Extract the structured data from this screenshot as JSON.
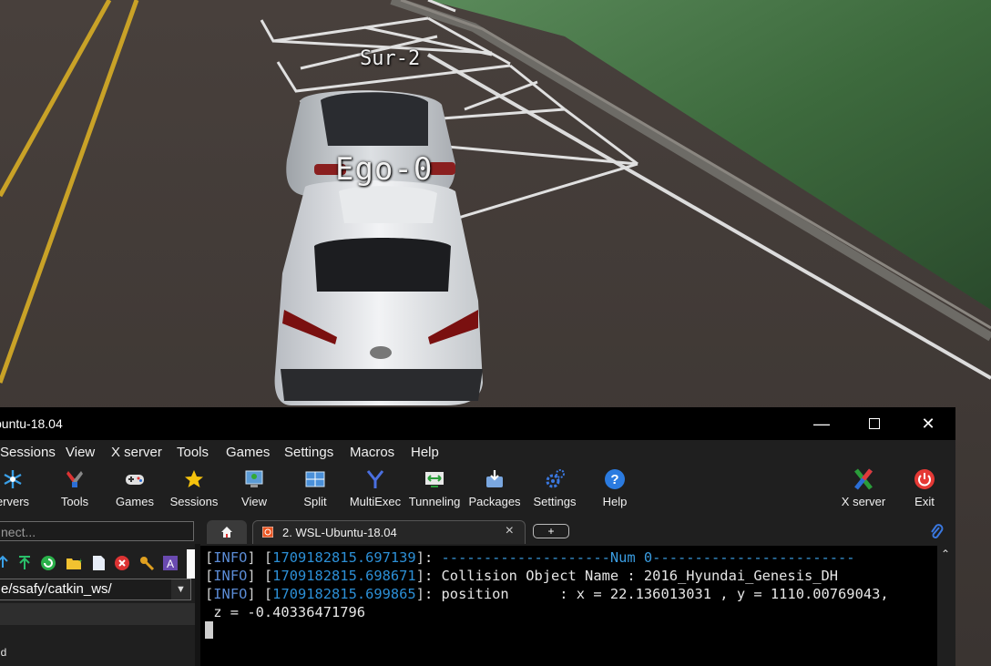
{
  "scene": {
    "surrounding_label": "Sur-2",
    "ego_label": "Ego-0"
  },
  "window": {
    "title": "buntu-18.04",
    "controls": [
      "minimize",
      "maximize",
      "close"
    ]
  },
  "menu": [
    "Sessions",
    "View",
    "X server",
    "Tools",
    "Games",
    "Settings",
    "Macros",
    "Help"
  ],
  "toolbar": {
    "left": [
      {
        "label": "ervers",
        "icon": "servers-icon"
      },
      {
        "label": "Tools",
        "icon": "tools-icon"
      },
      {
        "label": "Games",
        "icon": "gamepad-icon"
      },
      {
        "label": "Sessions",
        "icon": "star-icon"
      },
      {
        "label": "View",
        "icon": "view-icon"
      },
      {
        "label": "Split",
        "icon": "split-icon"
      },
      {
        "label": "MultiExec",
        "icon": "multiexec-icon"
      },
      {
        "label": "Tunneling",
        "icon": "tunneling-icon"
      },
      {
        "label": "Packages",
        "icon": "packages-icon"
      },
      {
        "label": "Settings",
        "icon": "settings-icon"
      },
      {
        "label": "Help",
        "icon": "help-icon"
      }
    ],
    "right": [
      {
        "label": "X server",
        "icon": "xserver-icon"
      },
      {
        "label": "Exit",
        "icon": "power-icon"
      }
    ]
  },
  "sidebar": {
    "connect_placeholder": "nect...",
    "path": "e/ssafy/catkin_ws/",
    "tree_item": "ld"
  },
  "tabs": {
    "home_icon": "home-icon",
    "active_tab": "2. WSL-Ubuntu-18.04",
    "new_tab_label": "+"
  },
  "terminal": {
    "lines": [
      {
        "level": "INFO",
        "timestamp": "1709182815.697139",
        "message": "--------------------Num 0------------------------"
      },
      {
        "level": "INFO",
        "timestamp": "1709182815.698671",
        "message": "Collision Object Name : 2016_Hyundai_Genesis_DH"
      },
      {
        "level": "INFO",
        "timestamp": "1709182815.699865",
        "message": "position      : x = 22.136013031 , y = 1110.00769043,"
      }
    ],
    "continuation": " z = -0.40336471796"
  },
  "colors": {
    "terminal_bg": "#000000",
    "timestamp": "#2c8fd6",
    "window_bg": "#1f1f1f",
    "exit_red": "#e53935"
  }
}
